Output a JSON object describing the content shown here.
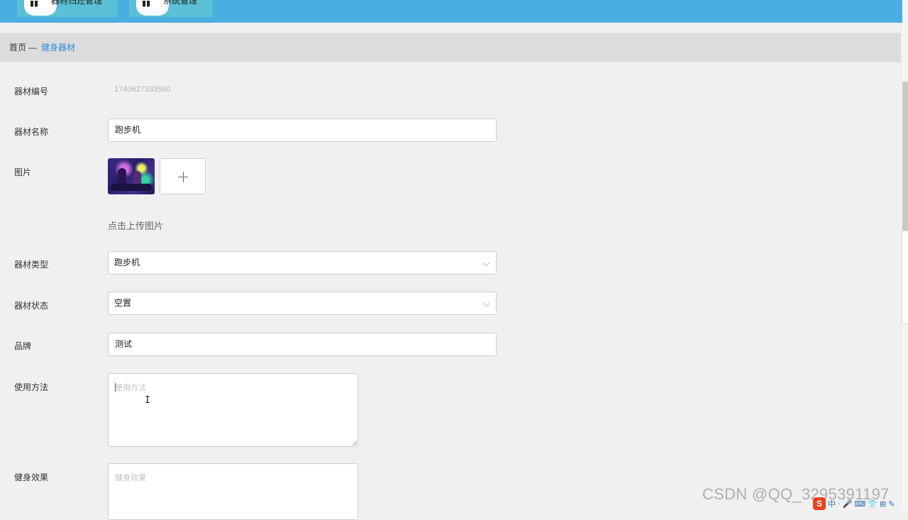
{
  "top_nav": {
    "tabs": [
      {
        "label": "器材归还管理",
        "icon": "grid-icon"
      },
      {
        "label": "系统管理",
        "icon": "grid-icon"
      }
    ]
  },
  "breadcrumb": {
    "home": "首页",
    "separator": "—",
    "current": "健身器材"
  },
  "form": {
    "equipment_id": {
      "label": "器材编号",
      "value": "1740627333580"
    },
    "equipment_name": {
      "label": "器材名称",
      "value": "跑步机"
    },
    "image": {
      "label": "图片",
      "upload_hint": "点击上传图片",
      "upload_icon": "plus-icon"
    },
    "equipment_type": {
      "label": "器材类型",
      "selected": "跑步机"
    },
    "equipment_status": {
      "label": "器材状态",
      "selected": "空置"
    },
    "brand": {
      "label": "品牌",
      "value": "测试"
    },
    "usage": {
      "label": "使用方法",
      "placeholder": "使用方法",
      "value": ""
    },
    "effect": {
      "label": "健身效果",
      "placeholder": "健身效果",
      "value": ""
    }
  },
  "watermark": "CSDN @QQ_3295391197",
  "tray": {
    "logo": "S",
    "items": [
      "中",
      "·",
      "🎤",
      "⌨",
      "👕",
      "⊞",
      "✎"
    ]
  },
  "colors": {
    "header_bg": "#4aaee3",
    "tab_bg": "#5bbfd5",
    "breadcrumb_active": "#2b8ad8",
    "page_bg": "#f0f0f0"
  }
}
